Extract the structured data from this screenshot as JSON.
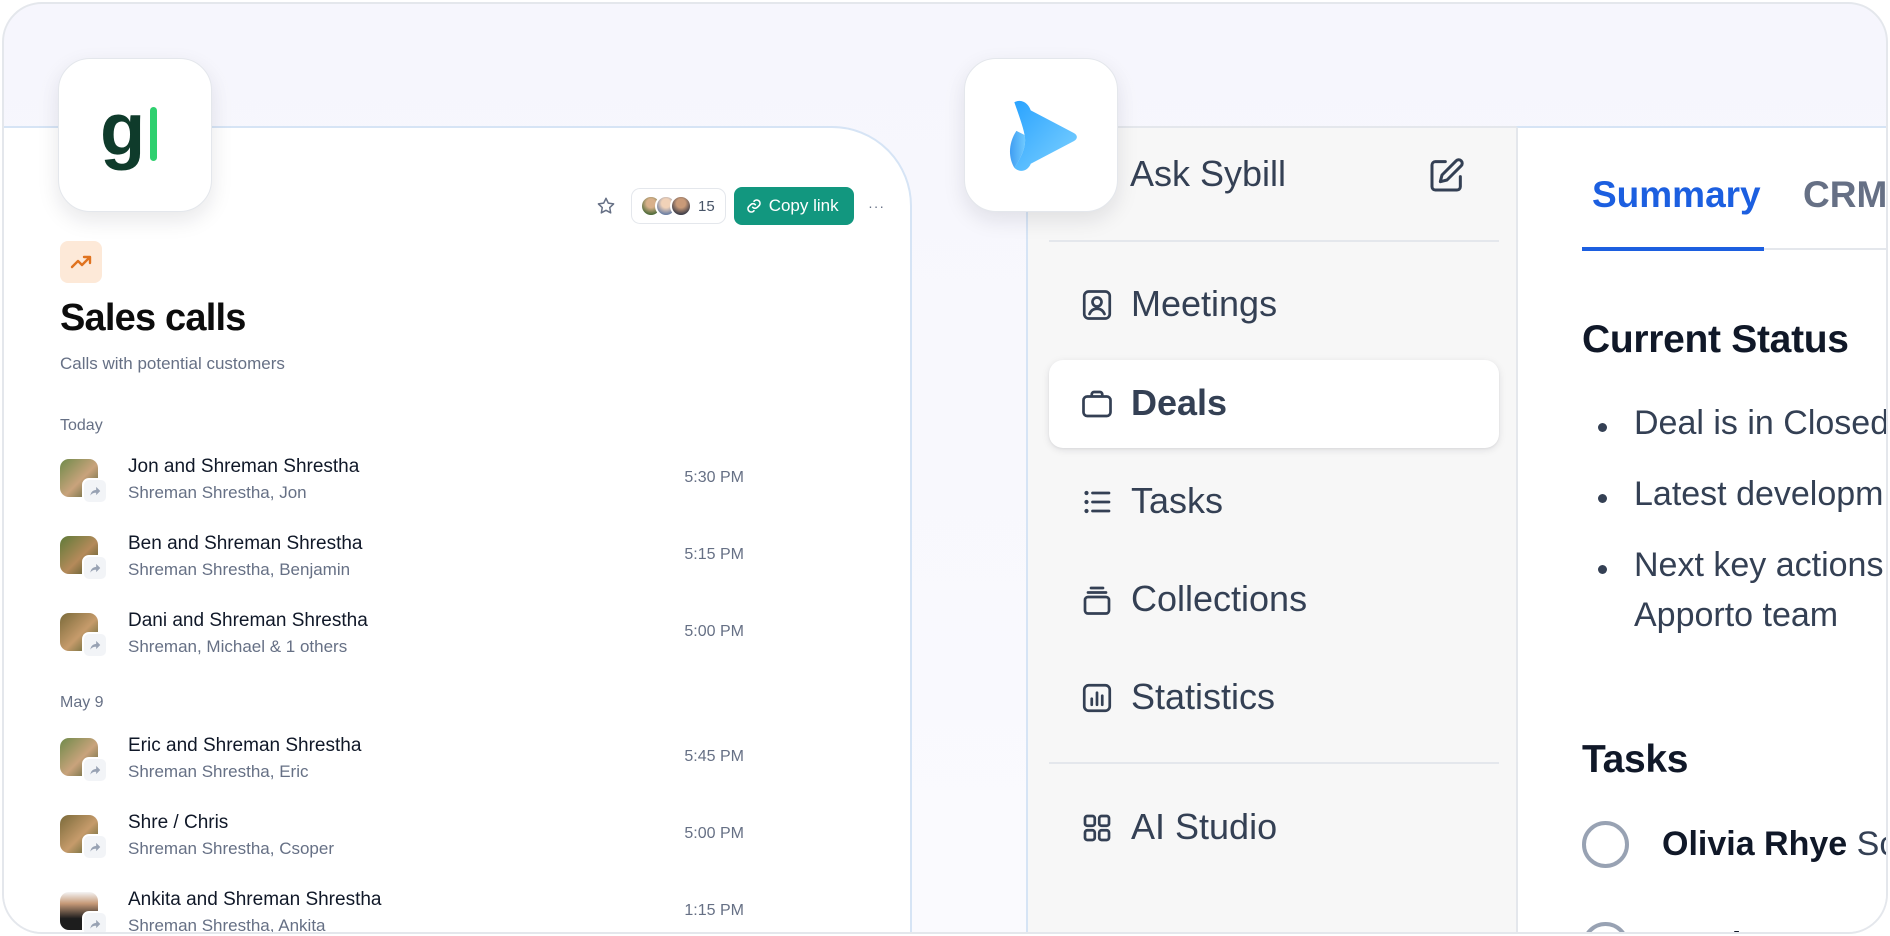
{
  "left_panel": {
    "toolbar": {
      "collaborator_count": "15",
      "copy_link_label": "Copy link",
      "more_label": "···"
    },
    "title": "Sales calls",
    "subtitle": "Calls with potential customers",
    "groups": [
      {
        "label": "Today",
        "calls": [
          {
            "name": "Jon and Shreman Shrestha",
            "people": "Shreman Shrestha, Jon",
            "time": "5:30 PM"
          },
          {
            "name": "Ben and Shreman Shrestha",
            "people": "Shreman Shrestha, Benjamin",
            "time": "5:15 PM"
          },
          {
            "name": "Dani and Shreman Shrestha",
            "people": "Shreman, Michael & 1 others",
            "time": "5:00 PM"
          }
        ]
      },
      {
        "label": "May 9",
        "calls": [
          {
            "name": "Eric and Shreman Shrestha",
            "people": "Shreman Shrestha, Eric",
            "time": "5:45 PM"
          },
          {
            "name": "Shre / Chris",
            "people": "Shreman Shrestha, Csoper",
            "time": "5:00 PM"
          },
          {
            "name": "Ankita and Shreman Shrestha",
            "people": "Shreman Shrestha, Ankita",
            "time": "1:15 PM"
          }
        ]
      }
    ]
  },
  "nav": {
    "ask_label": "Ask Sybill",
    "items": [
      {
        "label": "Meetings",
        "icon": "meetings-icon",
        "active": false
      },
      {
        "label": "Deals",
        "icon": "briefcase-icon",
        "active": true
      },
      {
        "label": "Tasks",
        "icon": "list-icon",
        "active": false
      },
      {
        "label": "Collections",
        "icon": "stack-icon",
        "active": false
      },
      {
        "label": "Statistics",
        "icon": "bar-chart-icon",
        "active": false
      }
    ],
    "ai_studio_label": "AI Studio"
  },
  "content": {
    "tabs": [
      "Summary",
      "CRM"
    ],
    "current_status_heading": "Current Status",
    "bullets": [
      "Deal is in Closed",
      "Latest developm",
      "Next key actions"
    ],
    "bullet_continuation": "Apporto team",
    "tasks_heading": "Tasks",
    "tasks": [
      {
        "assignee": "Olivia Rhye",
        "text": "Sc"
      },
      {
        "assignee": "Matthew S",
        "text": ""
      }
    ]
  },
  "colors": {
    "accent_green": "#12977f",
    "accent_blue": "#1c5fe0",
    "badge_orange": "#fde9d8"
  }
}
